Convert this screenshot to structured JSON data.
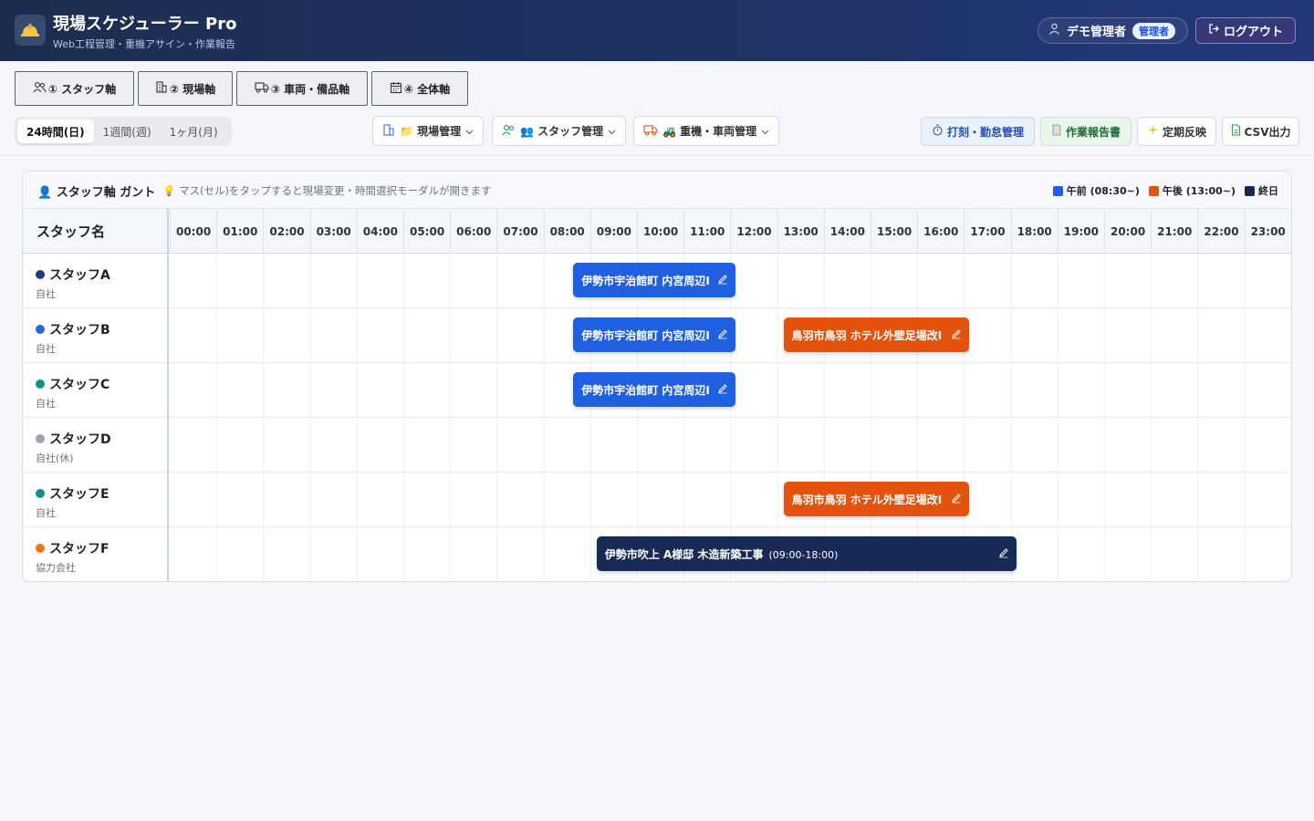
{
  "header": {
    "title": "現場スケジューラー Pro",
    "subtitle": "Web工程管理・重機アサイン・作業報告",
    "user_name": "デモ管理者",
    "role_badge": "管理者",
    "logout_label": "ログアウト"
  },
  "axis_tabs": [
    {
      "label": "① スタッフ軸",
      "icon": "users-icon"
    },
    {
      "label": "② 現場軸",
      "icon": "building-icon"
    },
    {
      "label": "③ 車両・備品軸",
      "icon": "truck-icon"
    },
    {
      "label": "④ 全体軸",
      "icon": "calendar-icon"
    }
  ],
  "period_buttons": [
    {
      "label": "24時間(日)",
      "active": true
    },
    {
      "label": "1週間(週)",
      "active": false
    },
    {
      "label": "1ヶ月(月)",
      "active": false
    }
  ],
  "menus": [
    {
      "label": "📁 現場管理",
      "icon": "building-icon"
    },
    {
      "label": "👥 スタッフ管理",
      "icon": "users-icon"
    },
    {
      "label": "🚜 重機・車両管理",
      "icon": "truck-icon"
    }
  ],
  "actions": [
    {
      "label": "打刻・勤怠管理",
      "icon": "stopwatch-icon"
    },
    {
      "label": "作業報告書",
      "icon": "document-icon"
    },
    {
      "label": "定期反映",
      "icon": "sparkle-icon"
    },
    {
      "label": "CSV出力",
      "icon": "file-icon"
    }
  ],
  "gantt": {
    "title": "スタッフ軸 ガント",
    "hint": "マス(セル)をタップすると現場変更・時間選択モーダルが開きます",
    "legend": [
      {
        "label": "午前 (08:30~)",
        "color": "#1f5fe0"
      },
      {
        "label": "午後 (13:00~)",
        "color": "#e4530e"
      },
      {
        "label": "終日",
        "color": "#172a55"
      }
    ],
    "name_header": "スタッフ名",
    "hours": [
      "00:00",
      "01:00",
      "02:00",
      "03:00",
      "04:00",
      "05:00",
      "06:00",
      "07:00",
      "08:00",
      "09:00",
      "10:00",
      "11:00",
      "12:00",
      "13:00",
      "14:00",
      "15:00",
      "16:00",
      "17:00",
      "18:00",
      "19:00",
      "20:00",
      "21:00",
      "22:00",
      "23:00"
    ],
    "staff": [
      {
        "name": "スタッフA",
        "org": "自社",
        "color": "#1e3a8a"
      },
      {
        "name": "スタッフB",
        "org": "自社",
        "color": "#2563eb"
      },
      {
        "name": "スタッフC",
        "org": "自社",
        "color": "#0d9488"
      },
      {
        "name": "スタッフD",
        "org": "自社(休)",
        "color": "#9ca3af"
      },
      {
        "name": "スタッフE",
        "org": "自社",
        "color": "#0d9488"
      },
      {
        "name": "スタッフF",
        "org": "協力会社",
        "color": "#f97316"
      }
    ]
  },
  "assignments": [
    {
      "staff": 0,
      "label": "伊勢市宇治館町 内宮周辺I",
      "time": "",
      "kind": "am",
      "start": 8.5,
      "end": 12.0
    },
    {
      "staff": 1,
      "label": "伊勢市宇治館町 内宮周辺I",
      "time": "",
      "kind": "am",
      "start": 8.5,
      "end": 12.0
    },
    {
      "staff": 1,
      "label": "鳥羽市鳥羽 ホテル外壁足場改I",
      "time": "",
      "kind": "pm",
      "start": 13.0,
      "end": 17.0
    },
    {
      "staff": 2,
      "label": "伊勢市宇治館町 内宮周辺I",
      "time": "",
      "kind": "am",
      "start": 8.5,
      "end": 12.0
    },
    {
      "staff": 4,
      "label": "鳥羽市鳥羽 ホテル外壁足場改I",
      "time": "",
      "kind": "pm",
      "start": 13.0,
      "end": 17.0
    },
    {
      "staff": 5,
      "label": "伊勢市吹上 A様邸 木造新築工事",
      "time": "(09:00-18:00)",
      "kind": "all",
      "start": 9.0,
      "end": 18.0
    }
  ]
}
